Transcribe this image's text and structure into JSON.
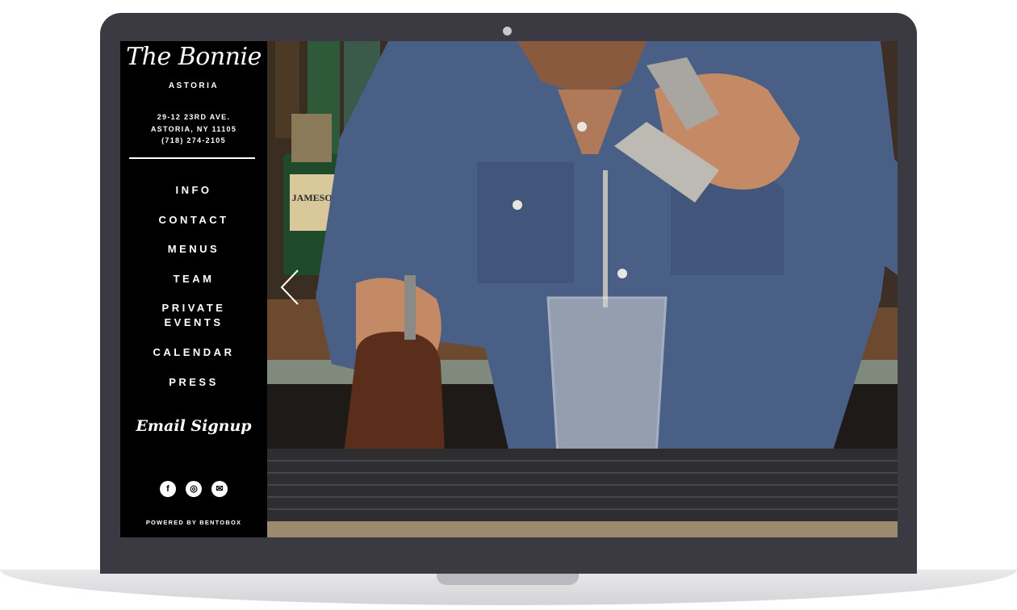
{
  "brand": {
    "name": "The Bonnie",
    "location": "ASTORIA",
    "address_line1": "29-12 23RD AVE.",
    "address_line2": "ASTORIA, NY 11105",
    "phone": "(718) 274-2105"
  },
  "nav": [
    {
      "label": "INFO"
    },
    {
      "label": "CONTACT"
    },
    {
      "label": "MENUS"
    },
    {
      "label": "TEAM"
    },
    {
      "label": "PRIVATE EVENTS"
    },
    {
      "label": "CALENDAR"
    },
    {
      "label": "PRESS"
    }
  ],
  "email_signup": "Email Signup",
  "social": [
    {
      "icon": "facebook-icon",
      "glyph": "f"
    },
    {
      "icon": "instagram-icon",
      "glyph": "◎"
    },
    {
      "icon": "mail-icon",
      "glyph": "✉"
    }
  ],
  "footer": "POWERED BY BENTOBOX",
  "hero": {
    "bottle_label": "JAMESON",
    "arrow": "chevron-left-icon"
  },
  "colors": {
    "sidebar_bg": "#000000",
    "bezel": "#3b3a42",
    "shirt": "#4a5f86",
    "bar_mat": "#2e2e30"
  }
}
